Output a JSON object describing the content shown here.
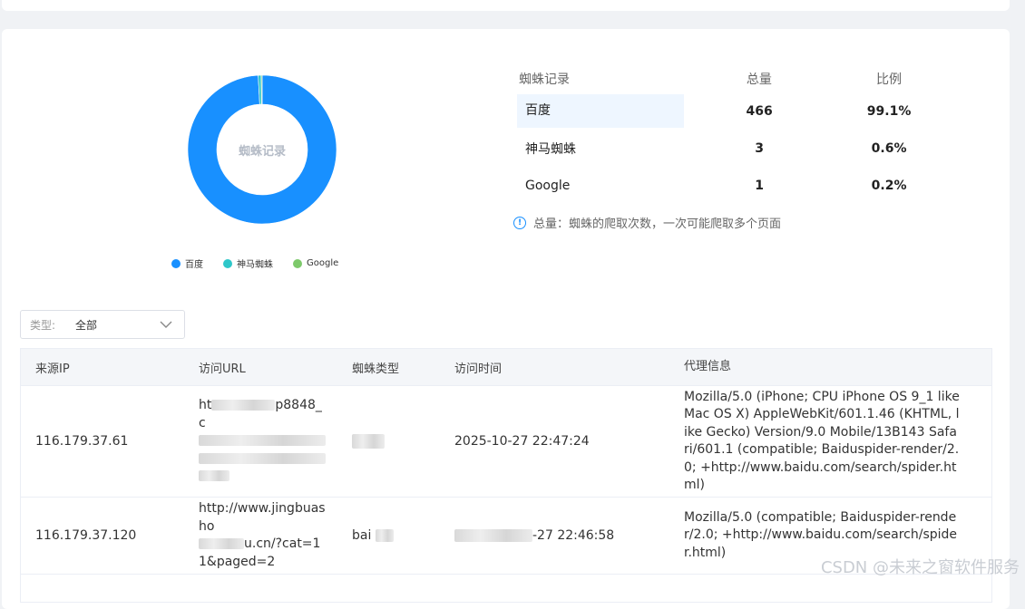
{
  "chart_data": {
    "type": "pie",
    "center_label": "蜘蛛记录",
    "categories": [
      "百度",
      "神马蜘蛛",
      "Google"
    ],
    "values": [
      466,
      3,
      1
    ],
    "colors": [
      "#1890ff",
      "#2ec7c9",
      "#7dc96b"
    ],
    "legend_position": "bottom"
  },
  "stats": {
    "headers": [
      "蜘蛛记录",
      "总量",
      "比例"
    ],
    "rows": [
      {
        "name": "百度",
        "total": "466",
        "ratio": "99.1%"
      },
      {
        "name": "神马蜘蛛",
        "total": "3",
        "ratio": "0.6%"
      },
      {
        "name": "Google",
        "total": "1",
        "ratio": "0.2%"
      }
    ],
    "note": "总量：蜘蛛的爬取次数，一次可能爬取多个页面"
  },
  "filter": {
    "label": "类型:",
    "value": "全部"
  },
  "table": {
    "headers": [
      "来源IP",
      "访问URL",
      "蜘蛛类型",
      "访问时间",
      "代理信息"
    ],
    "rows": [
      {
        "ip": "116.179.37.61",
        "url": "ht",
        "url_tail": "p8848_c",
        "type": "",
        "time": "2025-10-27 22:47:24",
        "ua": "Mozilla/5.0 (iPhone; CPU iPhone OS 9_1 like Mac OS X) AppleWebKit/601.1.46 (KHTML, like Gecko) Version/9.0 Mobile/13B143 Safari/601.1 (compatible; Baiduspider-render/2.0; +http://www.baidu.com/search/spider.html)"
      },
      {
        "ip": "116.179.37.120",
        "url": "http://www.jingbuasho",
        "url_tail": "u.cn/?cat=11&paged=2",
        "type": "bai",
        "time": "-27 22:46:58",
        "ua": "Mozilla/5.0 (compatible; Baiduspider-render/2.0; +http://www.baidu.com/search/spider.html)"
      }
    ]
  },
  "watermark": "CSDN @未来之窗软件服务"
}
